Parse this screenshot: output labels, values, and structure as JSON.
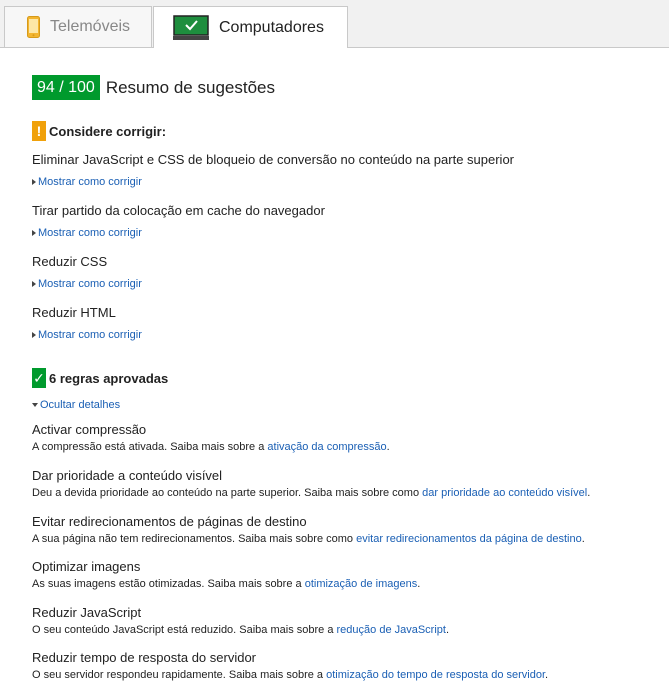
{
  "tabs": {
    "mobile_label": "Telemóveis",
    "desktop_label": "Computadores"
  },
  "summary": {
    "score": "94 / 100",
    "title": "Resumo de sugestões"
  },
  "consider": {
    "badge": "!",
    "title": "Considere corrigir:",
    "link_label": "Mostrar como corrigir",
    "rules": [
      "Eliminar JavaScript e CSS de bloqueio de conversão no conteúdo na parte superior",
      "Tirar partido da colocação em cache do navegador",
      "Reduzir CSS",
      "Reduzir HTML"
    ]
  },
  "passed": {
    "badge": "✓",
    "title": "6 regras aprovadas",
    "hide_label": "Ocultar detalhes",
    "rules": [
      {
        "title": "Activar compressão",
        "text": "A compressão está ativada. Saiba mais sobre a ",
        "link": "ativação da compressão",
        "end": "."
      },
      {
        "title": "Dar prioridade a conteúdo visível",
        "text": "Deu a devida prioridade ao conteúdo na parte superior. Saiba mais sobre como ",
        "link": "dar prioridade ao conteúdo visível",
        "end": "."
      },
      {
        "title": "Evitar redirecionamentos de páginas de destino",
        "text": "A sua página não tem redirecionamentos. Saiba mais sobre como ",
        "link": "evitar redirecionamentos da página de destino",
        "end": "."
      },
      {
        "title": "Optimizar imagens",
        "text": "As suas imagens estão otimizadas. Saiba mais sobre a ",
        "link": "otimização de imagens",
        "end": "."
      },
      {
        "title": "Reduzir JavaScript",
        "text": "O seu conteúdo JavaScript está reduzido. Saiba mais sobre a ",
        "link": "redução de JavaScript",
        "end": "."
      },
      {
        "title": "Reduzir tempo de resposta do servidor",
        "text": "O seu servidor respondeu rapidamente. Saiba mais sobre a ",
        "link": "otimização do tempo de resposta do servidor",
        "end": "."
      }
    ]
  },
  "colors": {
    "score_bg": "#009a2d",
    "warn": "#f0a10b",
    "link": "#1a5fb4"
  }
}
